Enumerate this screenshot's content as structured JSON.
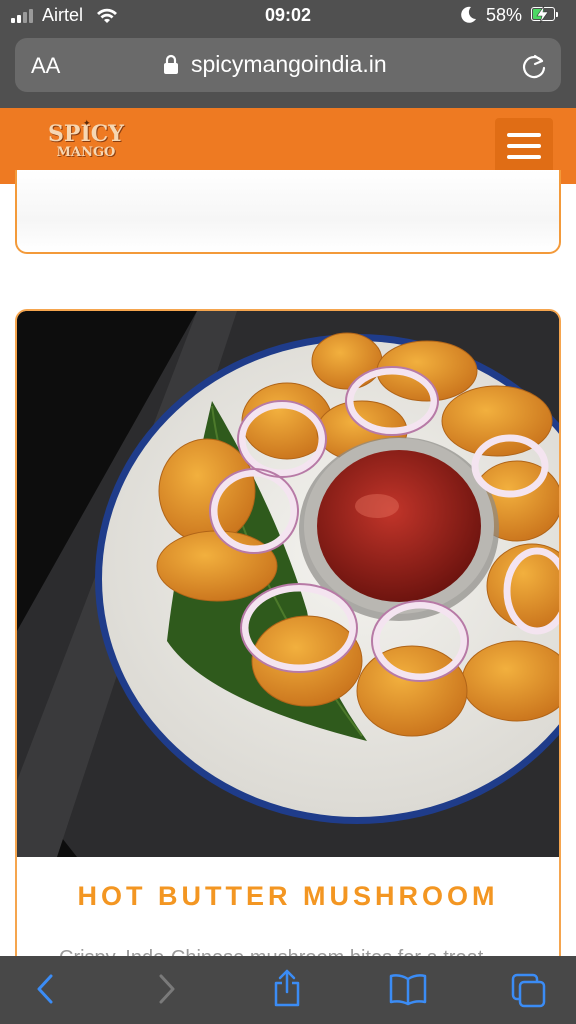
{
  "status_bar": {
    "carrier": "Airtel",
    "time": "09:02",
    "battery_percent": "58%",
    "battery_level": 0.58,
    "icons": [
      "signal-icon",
      "wifi-icon",
      "moon-icon",
      "battery-icon",
      "charging-bolt-icon"
    ]
  },
  "address_bar": {
    "text_size_label": "AA",
    "url": "spicymangoindia.in",
    "icons": [
      "lock-icon",
      "reload-icon"
    ]
  },
  "site_header": {
    "logo_line1": "SPICY",
    "logo_line2": "MANGO",
    "menu_icon": "hamburger-menu-icon"
  },
  "product_card": {
    "image_alt": "Hot Butter Mushroom dish",
    "title": "HOT BUTTER MUSHROOM",
    "description_partial": "Crispy, Indo-Chinese mushroom bites for a treat"
  },
  "toolbar": {
    "icons": [
      "back-icon",
      "forward-icon",
      "share-icon",
      "bookmarks-icon",
      "tabs-icon"
    ]
  },
  "colors": {
    "brand_orange": "#ee7a22",
    "title_orange": "#f39622",
    "ios_blue": "#3b8cf5",
    "chrome_gray": "#505050"
  }
}
